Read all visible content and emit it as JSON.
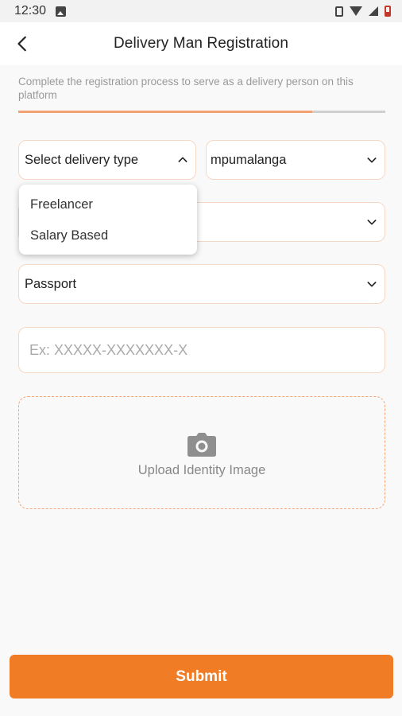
{
  "status_bar": {
    "time": "12:30",
    "icons": [
      "image-icon",
      "vibrate-icon",
      "wifi-icon",
      "signal-icon",
      "battery-icon"
    ]
  },
  "header": {
    "title": "Delivery Man Registration",
    "back_icon": "back-arrow-icon"
  },
  "subtitle": "Complete the registration process to serve as a delivery person on this platform",
  "progress": {
    "fraction": 0.8
  },
  "form": {
    "delivery_type": {
      "value": "Select delivery type",
      "expanded": true
    },
    "zone": {
      "value": "mpumalanga"
    },
    "second_select": {
      "value": ""
    },
    "identity_type": {
      "value": "Passport"
    },
    "identity_number": {
      "value": "",
      "placeholder": "Ex: XXXXX-XXXXXXX-X"
    },
    "upload": {
      "label": "Upload Identity Image",
      "icon": "camera-icon"
    }
  },
  "dropdown": {
    "options": [
      "Freelancer",
      "Salary Based"
    ]
  },
  "submit_label": "Submit",
  "colors": {
    "accent": "#f07c26",
    "field_border": "#f6d7c4",
    "dashed_border": "#f4a67a",
    "progress_fill": "#f2a272",
    "progress_track": "#cfcfcf"
  }
}
